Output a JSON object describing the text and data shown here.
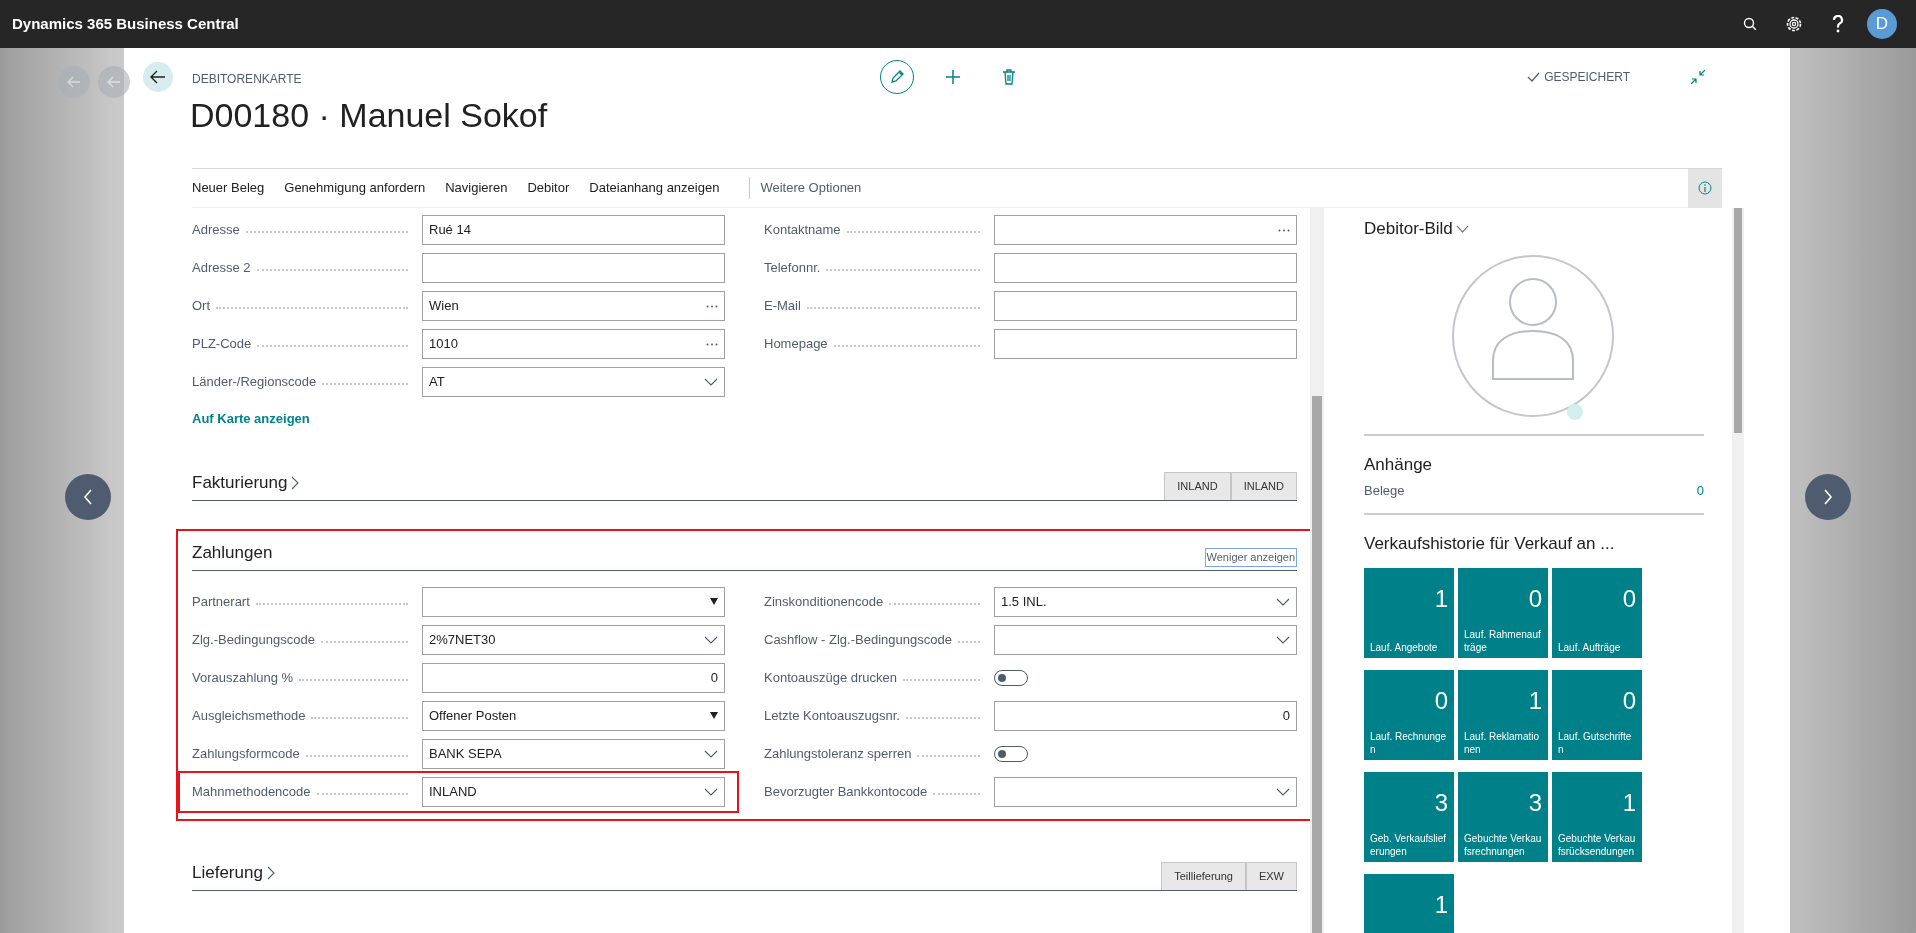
{
  "app": {
    "title": "Dynamics 365 Business Central",
    "user_initial": "D"
  },
  "page": {
    "caption": "DEBITORENKARTE",
    "title": "D00180 · Manuel Sokof",
    "save_status": "GESPEICHERT"
  },
  "actions": [
    {
      "label": "Neuer Beleg",
      "kind": "action"
    },
    {
      "label": "Genehmigung anfordern",
      "kind": "action"
    },
    {
      "label": "Navigieren",
      "kind": "action"
    },
    {
      "label": "Debitor",
      "kind": "action"
    },
    {
      "label": "Dateianhang anzeigen",
      "kind": "action"
    },
    {
      "label": "Weitere Optionen",
      "kind": "more"
    }
  ],
  "general": {
    "left_fields": [
      {
        "label": "Adresse",
        "value": "Rué 14",
        "kind": "text"
      },
      {
        "label": "Adresse 2",
        "kind": "text"
      },
      {
        "label": "Ort",
        "value": "Wien",
        "kind": "lookup"
      },
      {
        "label": "PLZ-Code",
        "value": "1010",
        "kind": "lookup"
      },
      {
        "label": "Länder-/Regionscode",
        "value": "AT",
        "kind": "dropdown"
      }
    ],
    "right_fields": [
      {
        "label": "Kontaktname",
        "kind": "lookup"
      },
      {
        "label": "Telefonnr.",
        "kind": "text"
      },
      {
        "label": "E-Mail",
        "kind": "text"
      },
      {
        "label": "Homepage",
        "kind": "text"
      }
    ],
    "link": "Auf Karte anzeigen"
  },
  "sections": [
    {
      "title": "Fakturierung",
      "expanded": false,
      "highlighted": false,
      "tags": [
        "INLAND",
        "INLAND"
      ]
    },
    {
      "title": "Zahlungen",
      "expanded": true,
      "highlighted": true,
      "toggle_label": "Weniger anzeigen",
      "left_fields": [
        {
          "label": "Partnerart",
          "kind": "select",
          "highlighted": false
        },
        {
          "label": "Zlg.-Bedingungscode",
          "value": "2%7NET30",
          "kind": "dropdown",
          "highlighted": false
        },
        {
          "label": "Vorauszahlung %",
          "value": "0",
          "kind": "number",
          "highlighted": false
        },
        {
          "label": "Ausgleichsmethode",
          "value": "Offener Posten",
          "kind": "select",
          "highlighted": false
        },
        {
          "label": "Zahlungsformcode",
          "value": "BANK SEPA",
          "kind": "dropdown",
          "highlighted": false
        },
        {
          "label": "Mahnmethodencode",
          "value": "INLAND",
          "kind": "dropdown",
          "highlighted": true
        }
      ],
      "right_fields": [
        {
          "label": "Zinskonditionencode",
          "value": "1.5 INL.",
          "kind": "dropdown",
          "highlighted": false
        },
        {
          "label": "Cashflow - Zlg.-Bedingungscode",
          "kind": "dropdown",
          "highlighted": false
        },
        {
          "label": "Kontoauszüge drucken",
          "kind": "toggle",
          "on": false,
          "highlighted": false
        },
        {
          "label": "Letzte Kontoauszugsnr.",
          "value": "0",
          "kind": "number",
          "highlighted": false
        },
        {
          "label": "Zahlungstoleranz sperren",
          "kind": "toggle",
          "on": false,
          "highlighted": false
        },
        {
          "label": "Bevorzugter Bankkontocode",
          "kind": "dropdown",
          "highlighted": false
        }
      ]
    },
    {
      "title": "Lieferung",
      "expanded": false,
      "highlighted": false,
      "tags": [
        "Teillieferung",
        "EXW"
      ]
    }
  ],
  "factbox": {
    "picture_title": "Debitor-Bild",
    "attachments": {
      "title": "Anhänge",
      "label": "Belege",
      "value": "0"
    },
    "history_title": "Verkaufshistorie für Verkauf an ...",
    "tiles": [
      {
        "value": "1",
        "label": "Lauf. Angebote"
      },
      {
        "value": "0",
        "label": "Lauf. Rahmenaufträge"
      },
      {
        "value": "0",
        "label": "Lauf. Aufträge"
      },
      {
        "value": "0",
        "label": "Lauf. Rechnungen"
      },
      {
        "value": "1",
        "label": "Lauf. Reklamationen"
      },
      {
        "value": "0",
        "label": "Lauf. Gutschriften"
      },
      {
        "value": "3",
        "label": "Geb. Verkaufslieferungen"
      },
      {
        "value": "3",
        "label": "Gebuchte Verkaufsrechnungen"
      },
      {
        "value": "1",
        "label": "Gebuchte Verkaufsrücksendungen"
      },
      {
        "value": "1"
      }
    ]
  }
}
